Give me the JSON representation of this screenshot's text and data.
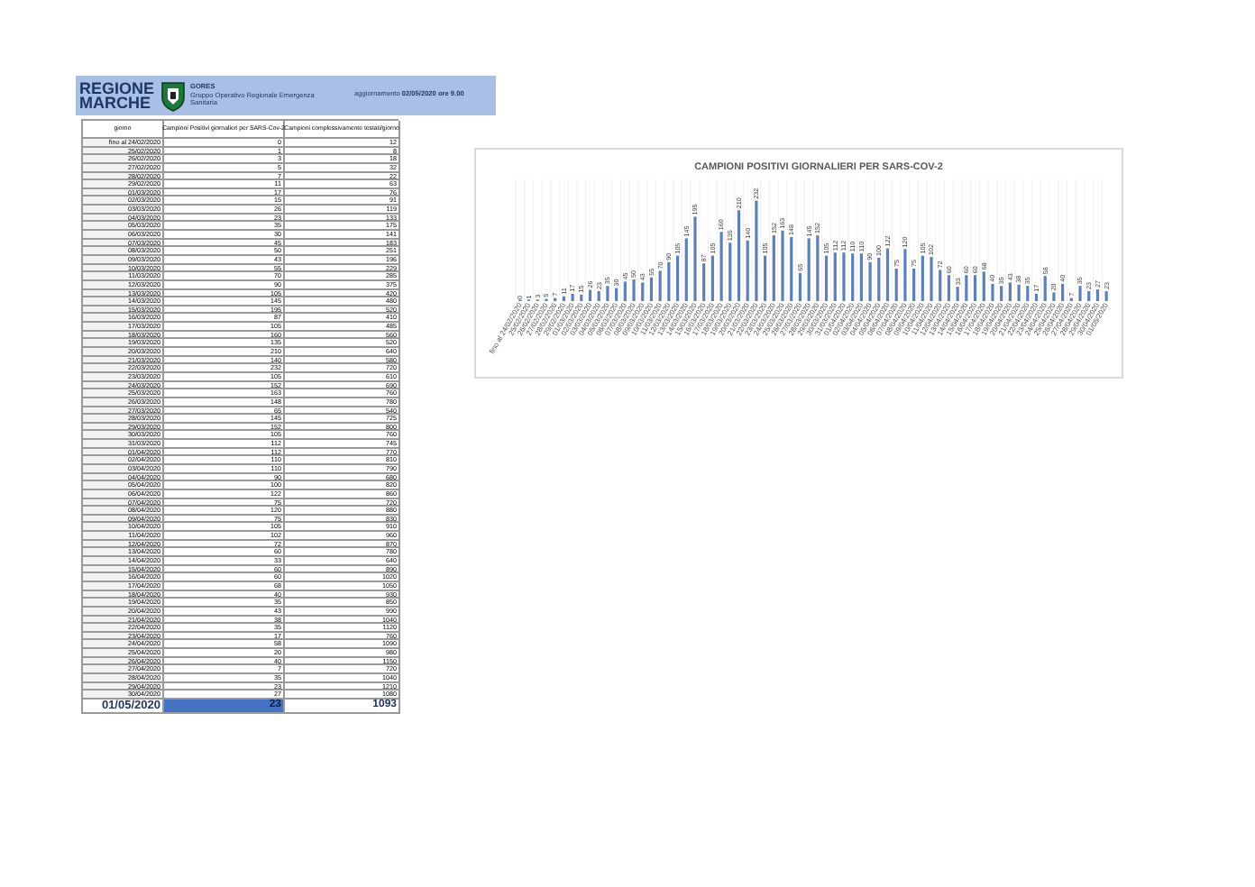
{
  "header": {
    "logo_line_1": "REGIONE",
    "logo_line_2": "MARCHE",
    "org_name": "GORES",
    "org_desc": "Gruppo Operativo Regionale Emergenza Sanitaria",
    "update": "aggiornamento **02/05/2020 ore 9.00**"
  },
  "table": {
    "columns": [
      "giorno",
      "Campioni Positivi giornalieri per SARS-Cov-2",
      "Campioni complessivamente testati/giorno"
    ],
    "rows": [
      {
        "date": "fino al 24/02/2020",
        "positives": "0",
        "tests": "12"
      },
      {
        "date": "25/02/2020",
        "positives": "1",
        "tests": "8"
      },
      {
        "date": "26/02/2020",
        "positives": "3",
        "tests": "18"
      },
      {
        "date": "27/02/2020",
        "positives": "5",
        "tests": "32"
      },
      {
        "date": "28/02/2020",
        "positives": "7",
        "tests": "22"
      },
      {
        "date": "29/02/2020",
        "positives": "11",
        "tests": "63"
      },
      {
        "date": "01/03/2020",
        "positives": "17",
        "tests": "76"
      },
      {
        "date": "02/03/2020",
        "positives": "15",
        "tests": "91"
      },
      {
        "date": "03/03/2020",
        "positives": "26",
        "tests": "119"
      },
      {
        "date": "04/03/2020",
        "positives": "23",
        "tests": "133"
      },
      {
        "date": "05/03/2020",
        "positives": "35",
        "tests": "175"
      },
      {
        "date": "06/03/2020",
        "positives": "30",
        "tests": "141"
      },
      {
        "date": "07/03/2020",
        "positives": "45",
        "tests": "183"
      },
      {
        "date": "08/03/2020",
        "positives": "50",
        "tests": "251"
      },
      {
        "date": "09/03/2020",
        "positives": "43",
        "tests": "196"
      },
      {
        "date": "10/03/2020",
        "positives": "55",
        "tests": "229"
      },
      {
        "date": "11/03/2020",
        "positives": "70",
        "tests": "285"
      },
      {
        "date": "12/03/2020",
        "positives": "90",
        "tests": "375"
      },
      {
        "date": "13/03/2020",
        "positives": "105",
        "tests": "420"
      },
      {
        "date": "14/03/2020",
        "positives": "145",
        "tests": "480"
      },
      {
        "date": "15/03/2020",
        "positives": "195",
        "tests": "520"
      },
      {
        "date": "16/03/2020",
        "positives": "87",
        "tests": "410"
      },
      {
        "date": "17/03/2020",
        "positives": "105",
        "tests": "485"
      },
      {
        "date": "18/03/2020",
        "positives": "160",
        "tests": "560"
      },
      {
        "date": "19/03/2020",
        "positives": "135",
        "tests": "520"
      },
      {
        "date": "20/03/2020",
        "positives": "210",
        "tests": "640"
      },
      {
        "date": "21/03/2020",
        "positives": "140",
        "tests": "580"
      },
      {
        "date": "22/03/2020",
        "positives": "232",
        "tests": "720"
      },
      {
        "date": "23/03/2020",
        "positives": "105",
        "tests": "610"
      },
      {
        "date": "24/03/2020",
        "positives": "152",
        "tests": "690"
      },
      {
        "date": "25/03/2020",
        "positives": "163",
        "tests": "760"
      },
      {
        "date": "26/03/2020",
        "positives": "148",
        "tests": "780"
      },
      {
        "date": "27/03/2020",
        "positives": "65",
        "tests": "540"
      },
      {
        "date": "28/03/2020",
        "positives": "145",
        "tests": "725"
      },
      {
        "date": "29/03/2020",
        "positives": "152",
        "tests": "800"
      },
      {
        "date": "30/03/2020",
        "positives": "105",
        "tests": "760"
      },
      {
        "date": "31/03/2020",
        "positives": "112",
        "tests": "745"
      },
      {
        "date": "01/04/2020",
        "positives": "112",
        "tests": "770"
      },
      {
        "date": "02/04/2020",
        "positives": "110",
        "tests": "810"
      },
      {
        "date": "03/04/2020",
        "positives": "110",
        "tests": "790"
      },
      {
        "date": "04/04/2020",
        "positives": "90",
        "tests": "680"
      },
      {
        "date": "05/04/2020",
        "positives": "100",
        "tests": "820"
      },
      {
        "date": "06/04/2020",
        "positives": "122",
        "tests": "860"
      },
      {
        "date": "07/04/2020",
        "positives": "75",
        "tests": "720"
      },
      {
        "date": "08/04/2020",
        "positives": "120",
        "tests": "880"
      },
      {
        "date": "09/04/2020",
        "positives": "75",
        "tests": "830"
      },
      {
        "date": "10/04/2020",
        "positives": "105",
        "tests": "910"
      },
      {
        "date": "11/04/2020",
        "positives": "102",
        "tests": "960"
      },
      {
        "date": "12/04/2020",
        "positives": "72",
        "tests": "870"
      },
      {
        "date": "13/04/2020",
        "positives": "60",
        "tests": "780"
      },
      {
        "date": "14/04/2020",
        "positives": "33",
        "tests": "640"
      },
      {
        "date": "15/04/2020",
        "positives": "60",
        "tests": "890"
      },
      {
        "date": "16/04/2020",
        "positives": "60",
        "tests": "1020"
      },
      {
        "date": "17/04/2020",
        "positives": "68",
        "tests": "1050"
      },
      {
        "date": "18/04/2020",
        "positives": "40",
        "tests": "930"
      },
      {
        "date": "19/04/2020",
        "positives": "35",
        "tests": "850"
      },
      {
        "date": "20/04/2020",
        "positives": "43",
        "tests": "990"
      },
      {
        "date": "21/04/2020",
        "positives": "38",
        "tests": "1040"
      },
      {
        "date": "22/04/2020",
        "positives": "35",
        "tests": "1120"
      },
      {
        "date": "23/04/2020",
        "positives": "17",
        "tests": "760"
      },
      {
        "date": "24/04/2020",
        "positives": "58",
        "tests": "1090"
      },
      {
        "date": "25/04/2020",
        "positives": "20",
        "tests": "980"
      },
      {
        "date": "26/04/2020",
        "positives": "40",
        "tests": "1150"
      },
      {
        "date": "27/04/2020",
        "positives": "7",
        "tests": "720"
      },
      {
        "date": "28/04/2020",
        "positives": "35",
        "tests": "1040"
      },
      {
        "date": "29/04/2020",
        "positives": "23",
        "tests": "1210"
      },
      {
        "date": "30/04/2020",
        "positives": "27",
        "tests": "1080"
      }
    ],
    "total_row": {
      "date": "01/05/2020",
      "positives": "23",
      "tests": "1093"
    }
  },
  "chart": {
    "chart_data": {
      "type": "bar",
      "title": "CAMPIONI POSITIVI GIORNALIERI PER SARS-COV-2",
      "grid": true,
      "data_labels": true,
      "categories": [
        "fino al 24/02/2020",
        "25/02/2020",
        "26/02/2020",
        "27/02/2020",
        "28/02/2020",
        "29/02/2020",
        "01/03/2020",
        "02/03/2020",
        "03/03/2020",
        "04/03/2020",
        "05/03/2020",
        "06/03/2020",
        "07/03/2020",
        "08/03/2020",
        "09/03/2020",
        "10/03/2020",
        "11/03/2020",
        "12/03/2020",
        "13/03/2020",
        "14/03/2020",
        "15/03/2020",
        "16/03/2020",
        "17/03/2020",
        "18/03/2020",
        "19/03/2020",
        "20/03/2020",
        "21/03/2020",
        "22/03/2020",
        "23/03/2020",
        "24/03/2020",
        "25/03/2020",
        "26/03/2020",
        "27/03/2020",
        "28/03/2020",
        "29/03/2020",
        "30/03/2020",
        "31/03/2020",
        "01/04/2020",
        "02/04/2020",
        "03/04/2020",
        "04/04/2020",
        "05/04/2020",
        "06/04/2020",
        "07/04/2020",
        "08/04/2020",
        "09/04/2020",
        "10/04/2020",
        "11/04/2020",
        "12/04/2020",
        "13/04/2020",
        "14/04/2020",
        "15/04/2020",
        "16/04/2020",
        "17/04/2020",
        "18/04/2020",
        "19/04/2020",
        "20/04/2020",
        "21/04/2020",
        "22/04/2020",
        "23/04/2020",
        "24/04/2020",
        "25/04/2020",
        "26/04/2020",
        "27/04/2020",
        "28/04/2020",
        "29/04/2020",
        "30/04/2020",
        "01/05/2020"
      ],
      "series": [
        {
          "color": "#5b7fc0",
          "values": [
            0,
            1,
            3,
            5,
            7,
            11,
            17,
            15,
            26,
            23,
            35,
            30,
            45,
            50,
            43,
            55,
            70,
            90,
            105,
            145,
            195,
            87,
            105,
            160,
            135,
            210,
            140,
            232,
            105,
            152,
            163,
            148,
            65,
            145,
            152,
            105,
            112,
            112,
            110,
            110,
            90,
            100,
            122,
            75,
            120,
            75,
            105,
            102,
            72,
            60,
            33,
            60,
            60,
            68,
            40,
            35,
            43,
            38,
            35,
            17,
            58,
            20,
            40,
            7,
            35,
            23,
            27,
            23
          ]
        }
      ]
    }
  }
}
